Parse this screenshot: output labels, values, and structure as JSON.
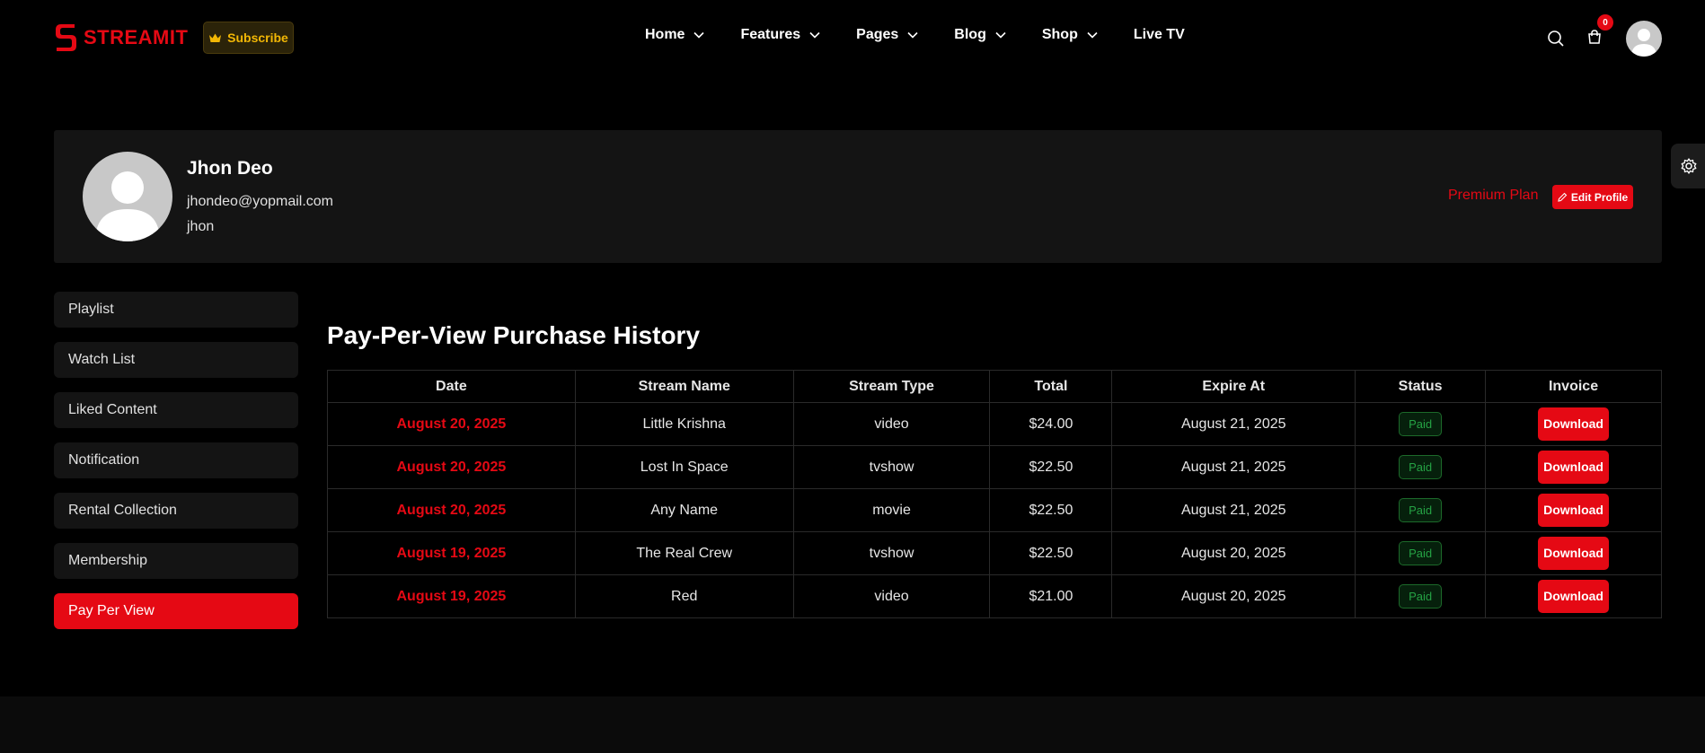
{
  "brand": {
    "name": "STREAMIT",
    "color": "#e50914"
  },
  "header": {
    "subscribe_label": "Subscribe",
    "nav": [
      {
        "label": "Home",
        "has_dropdown": true
      },
      {
        "label": "Features",
        "has_dropdown": true
      },
      {
        "label": "Pages",
        "has_dropdown": true
      },
      {
        "label": "Blog",
        "has_dropdown": true
      },
      {
        "label": "Shop",
        "has_dropdown": true
      },
      {
        "label": "Live TV",
        "has_dropdown": false
      }
    ],
    "cart_count": "0"
  },
  "profile": {
    "name": "Jhon Deo",
    "email": "jhondeo@yopmail.com",
    "username": "jhon",
    "plan": "Premium Plan",
    "edit_label": "Edit Profile"
  },
  "sidebar": {
    "items": [
      {
        "label": "Playlist",
        "active": false
      },
      {
        "label": "Watch List",
        "active": false
      },
      {
        "label": "Liked Content",
        "active": false
      },
      {
        "label": "Notification",
        "active": false
      },
      {
        "label": "Rental Collection",
        "active": false
      },
      {
        "label": "Membership",
        "active": false
      },
      {
        "label": "Pay Per View",
        "active": true
      }
    ]
  },
  "main": {
    "title": "Pay-Per-View Purchase History",
    "columns": [
      "Date",
      "Stream Name",
      "Stream Type",
      "Total",
      "Expire At",
      "Status",
      "Invoice"
    ],
    "rows": [
      {
        "date": "August 20, 2025",
        "stream_name": "Little Krishna",
        "stream_type": "video",
        "total": "$24.00",
        "expire_at": "August 21, 2025",
        "status": "Paid",
        "invoice": "Download"
      },
      {
        "date": "August 20, 2025",
        "stream_name": "Lost In Space",
        "stream_type": "tvshow",
        "total": "$22.50",
        "expire_at": "August 21, 2025",
        "status": "Paid",
        "invoice": "Download"
      },
      {
        "date": "August 20, 2025",
        "stream_name": "Any Name",
        "stream_type": "movie",
        "total": "$22.50",
        "expire_at": "August 21, 2025",
        "status": "Paid",
        "invoice": "Download"
      },
      {
        "date": "August 19, 2025",
        "stream_name": "The Real Crew",
        "stream_type": "tvshow",
        "total": "$22.50",
        "expire_at": "August 20, 2025",
        "status": "Paid",
        "invoice": "Download"
      },
      {
        "date": "August 19, 2025",
        "stream_name": "Red",
        "stream_type": "video",
        "total": "$21.00",
        "expire_at": "August 20, 2025",
        "status": "Paid",
        "invoice": "Download"
      }
    ]
  },
  "icons": {
    "logo": "streamit-s-logo",
    "subscribe": "crown-icon",
    "nav_dropdown": "chevron-down-icon",
    "search": "search-icon",
    "cart": "shopping-bag-icon",
    "avatar": "user-avatar",
    "edit": "pencil-icon",
    "settings": "gear-icon"
  }
}
